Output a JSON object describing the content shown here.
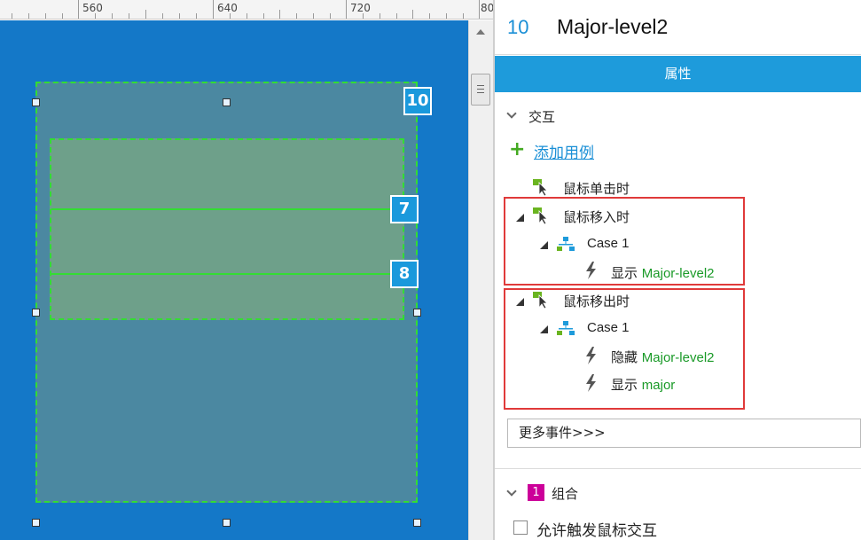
{
  "ruler": {
    "ticks": [
      "560",
      "640",
      "720",
      "80"
    ]
  },
  "canvas": {
    "badges": [
      "10",
      "7",
      "8"
    ]
  },
  "panel": {
    "widget_id": "10",
    "widget_name": "Major-level2",
    "tab_label": "属性",
    "interactions_label": "交互",
    "add_case_label": "添加用例",
    "events": [
      {
        "label": "鼠标单击时"
      },
      {
        "label": "鼠标移入时",
        "case": "Case 1",
        "actions": [
          {
            "verb": "显示",
            "target": "Major-level2"
          }
        ]
      },
      {
        "label": "鼠标移出时",
        "case": "Case 1",
        "actions": [
          {
            "verb": "隐藏",
            "target": "Major-level2"
          },
          {
            "verb": "显示",
            "target": "major"
          }
        ]
      }
    ],
    "more_events": "更多事件>>>",
    "group_section": {
      "count": "1",
      "label": "组合"
    },
    "allow_trigger_label": "允许触发鼠标交互"
  },
  "colors": {
    "accent_blue": "#1e9bdb",
    "canvas_blue": "#1478c8",
    "highlight_red": "#e03a3a",
    "action_green": "#1a9a28",
    "selection_green": "#33dd33"
  }
}
